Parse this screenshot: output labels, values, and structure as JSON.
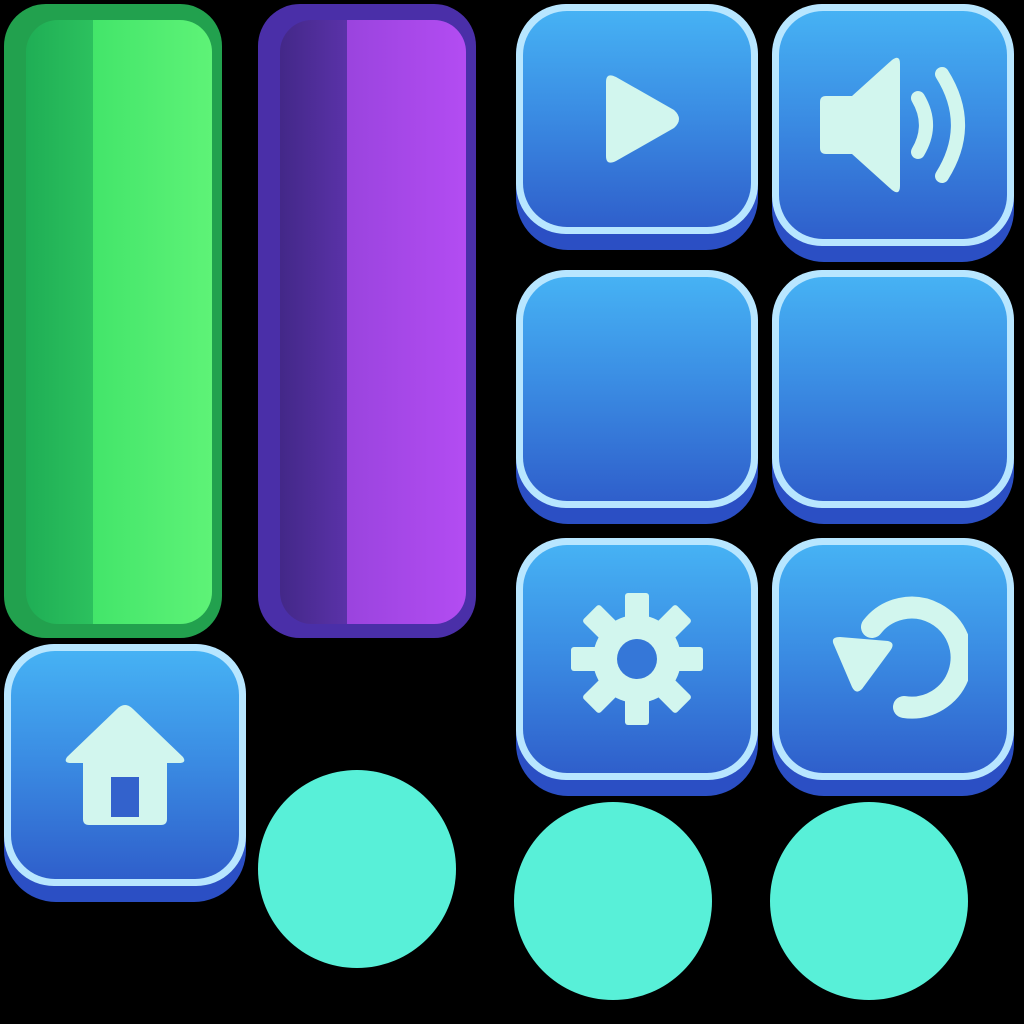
{
  "sheet": {
    "background": "#000000"
  },
  "bars": [
    {
      "name": "green-bar",
      "color": "#43e56a"
    },
    {
      "name": "purple-bar",
      "color": "#a347e6"
    }
  ],
  "buttons": [
    {
      "name": "play-button",
      "icon": "play-icon"
    },
    {
      "name": "sound-button",
      "icon": "speaker-icon"
    },
    {
      "name": "blank-button-1",
      "icon": ""
    },
    {
      "name": "blank-button-2",
      "icon": ""
    },
    {
      "name": "settings-button",
      "icon": "gear-icon"
    },
    {
      "name": "restart-button",
      "icon": "restart-icon"
    },
    {
      "name": "home-button",
      "icon": "home-icon"
    }
  ],
  "colors": {
    "button_top": "#46b2f4",
    "button_bottom": "#2f5fcb",
    "button_rim": "#b8e6ff",
    "icon": "#d2f6ee",
    "dot": "#58f0d8"
  }
}
